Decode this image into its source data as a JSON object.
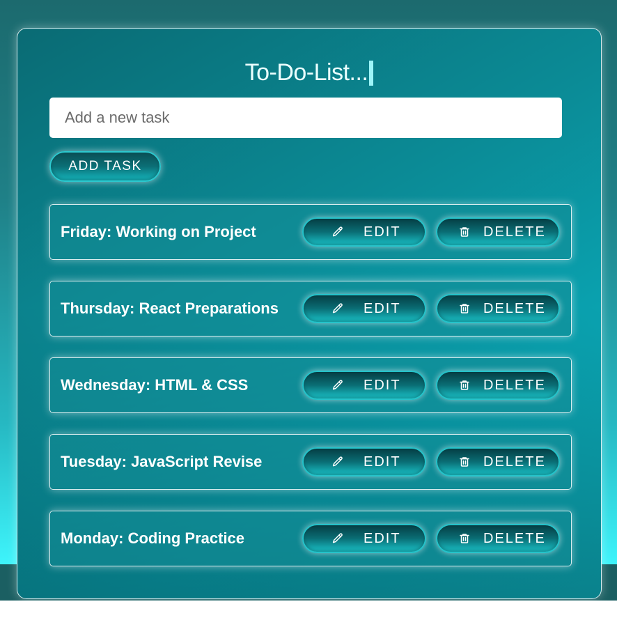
{
  "app": {
    "title": "To-Do-List..."
  },
  "input": {
    "placeholder": "Add a new task",
    "value": ""
  },
  "add_button": {
    "label": "ADD TASK"
  },
  "task_actions": {
    "edit_label": "EDIT",
    "edit_icon": "pencil-icon",
    "delete_label": "DELETE",
    "delete_icon": "trash-icon"
  },
  "tasks": [
    {
      "text": "Friday: Working on Project"
    },
    {
      "text": "Thursday: React Preparations"
    },
    {
      "text": "Wednesday: HTML & CSS"
    },
    {
      "text": "Tuesday: JavaScript Revise"
    },
    {
      "text": "Monday: Coding Practice"
    }
  ],
  "colors": {
    "card_accent": "#0aa3b1",
    "button_border": "#25c3ca",
    "text": "#ffffff"
  }
}
